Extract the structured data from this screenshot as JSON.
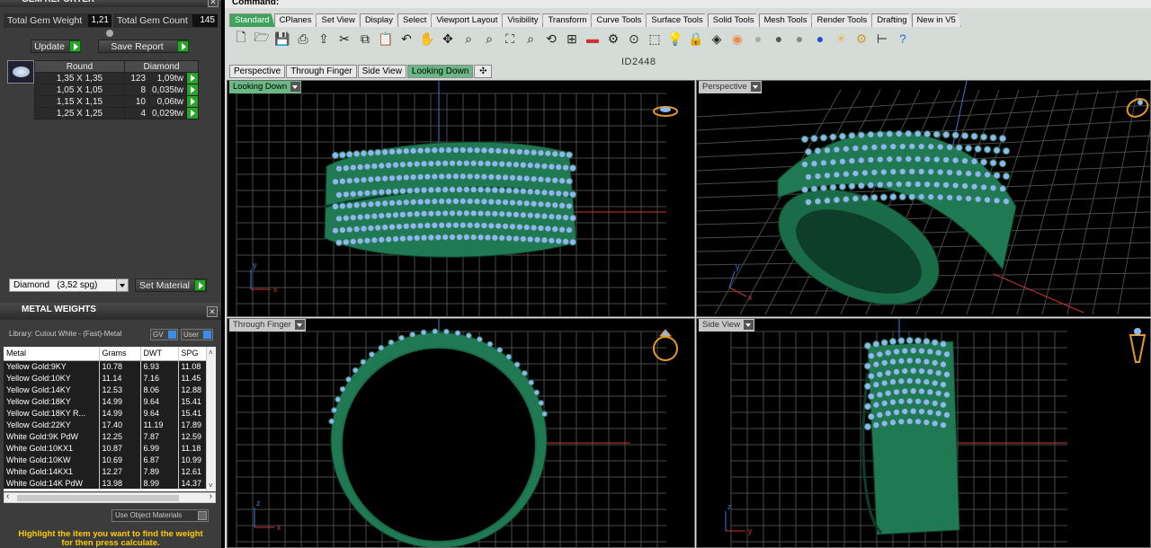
{
  "left_panel": {
    "title": "GEM REPORTER",
    "total_gem_weight_label": "Total Gem Weight",
    "total_gem_weight": "1,21",
    "total_gem_count_label": "Total Gem Count",
    "total_gem_count": "145",
    "update_label": "Update",
    "save_report_label": "Save Report",
    "gem_columns": [
      "Round",
      "Diamond"
    ],
    "gems": [
      {
        "size": "1,35 X 1,35",
        "count": "123",
        "weight": "1,09tw"
      },
      {
        "size": "1,05 X 1,05",
        "count": "8",
        "weight": "0,035tw"
      },
      {
        "size": "1,15 X 1,15",
        "count": "10",
        "weight": "0,06tw"
      },
      {
        "size": "1,25 X 1,25",
        "count": "4",
        "weight": "0,029tw"
      }
    ],
    "material_value": "Diamond   (3,52 spg)",
    "set_material_label": "Set Material"
  },
  "metal_weights": {
    "title": "METAL WEIGHTS",
    "library": "Library: Cutout White - (Fast)-Metal",
    "gv_label": "GV",
    "user_label": "User",
    "columns": [
      "Metal",
      "Grams",
      "DWT",
      "SPG"
    ],
    "rows": [
      {
        "metal": "Yellow Gold:9KY",
        "grams": "10.78",
        "dwt": "6.93",
        "spg": "11.08"
      },
      {
        "metal": "Yellow Gold:10KY",
        "grams": "11.14",
        "dwt": "7.16",
        "spg": "11.45"
      },
      {
        "metal": "Yellow Gold:14KY",
        "grams": "12.53",
        "dwt": "8.06",
        "spg": "12.88"
      },
      {
        "metal": "Yellow Gold:18KY",
        "grams": "14.99",
        "dwt": "9.64",
        "spg": "15.41"
      },
      {
        "metal": "Yellow Gold:18KY R...",
        "grams": "14.99",
        "dwt": "9.64",
        "spg": "15.41"
      },
      {
        "metal": "Yellow Gold:22KY",
        "grams": "17.40",
        "dwt": "11.19",
        "spg": "17.89"
      },
      {
        "metal": "White Gold:9K PdW",
        "grams": "12.25",
        "dwt": "7.87",
        "spg": "12.59"
      },
      {
        "metal": "White Gold:10KX1",
        "grams": "10.87",
        "dwt": "6.99",
        "spg": "11.18"
      },
      {
        "metal": "White Gold:10KW",
        "grams": "10.69",
        "dwt": "6.87",
        "spg": "10.99"
      },
      {
        "metal": "White Gold:14KX1",
        "grams": "12.27",
        "dwt": "7.89",
        "spg": "12.61"
      },
      {
        "metal": "White Gold:14K PdW",
        "grams": "13.98",
        "dwt": "8.99",
        "spg": "14.37"
      }
    ],
    "use_object_materials": "Use Object Materials",
    "hint_line1": "Highlight the item you want to find the weight",
    "hint_line2": "for then press calculate."
  },
  "rhino": {
    "command_label": "Command:",
    "toolbar_tabs": [
      "Standard",
      "CPlanes",
      "Set View",
      "Display",
      "Select",
      "Viewport Layout",
      "Visibility",
      "Transform",
      "Curve Tools",
      "Surface Tools",
      "Solid Tools",
      "Mesh Tools",
      "Render Tools",
      "Drafting",
      "New in V5"
    ],
    "active_toolbar_tab": "Standard",
    "toolbar_icons": [
      "new-file-icon",
      "open-folder-icon",
      "save-icon",
      "print-icon",
      "export-icon",
      "cut-icon",
      "copy-icon",
      "paste-icon",
      "undo-icon",
      "pan-hand-icon",
      "move-view-icon",
      "zoom-icon",
      "zoom-window-icon",
      "zoom-extents-icon",
      "zoom-selected-icon",
      "rotate-view-icon",
      "four-viewports-icon",
      "car-icon",
      "properties-icon",
      "object-snap-icon",
      "select-icon",
      "light-bulb-icon",
      "lock-icon",
      "layer-icon",
      "color-wheel-icon",
      "shaded-sphere-icon",
      "rendered-sphere-icon",
      "material-sphere-icon",
      "blue-sphere-icon",
      "light-icon",
      "settings-gear-icon",
      "dimension-icon",
      "help-icon"
    ],
    "model_id": "ID2448",
    "view_tabs": [
      "Perspective",
      "Through Finger",
      "Side View",
      "Looking Down"
    ],
    "active_view_tab": "Looking Down",
    "viewports": {
      "top_left": "Looking Down",
      "top_right": "Perspective",
      "bottom_left": "Through Finger",
      "bottom_right": "Side View"
    },
    "axis_labels": {
      "x": "x",
      "y": "y",
      "z": "z"
    }
  }
}
